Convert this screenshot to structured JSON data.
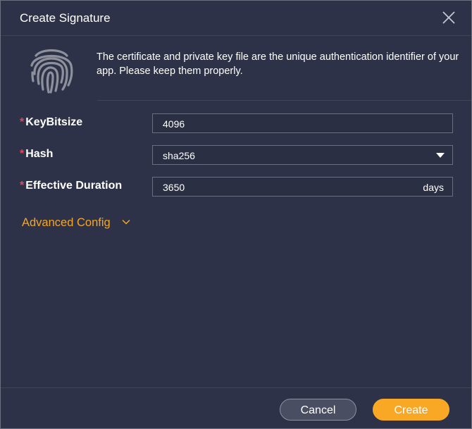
{
  "dialog": {
    "title": "Create Signature",
    "info_text": "The certificate and private key file are the unique authentication identifier of your app. Please keep them properly."
  },
  "form": {
    "required_mark": "*",
    "key_bitsize": {
      "label": "KeyBitsize",
      "value": "4096"
    },
    "hash": {
      "label": "Hash",
      "value": "sha256"
    },
    "effective_duration": {
      "label": "Effective Duration",
      "value": "3650",
      "unit": "days"
    },
    "advanced_config": {
      "label": "Advanced Config"
    }
  },
  "footer": {
    "cancel_label": "Cancel",
    "create_label": "Create"
  },
  "colors": {
    "background": "#2e3248",
    "accent": "#f9a825",
    "required": "#e0485a",
    "link": "#f5a623"
  },
  "icons": {
    "close": "close-icon",
    "fingerprint": "fingerprint-icon",
    "dropdown": "caret-down-icon",
    "expand": "chevron-down-icon"
  }
}
